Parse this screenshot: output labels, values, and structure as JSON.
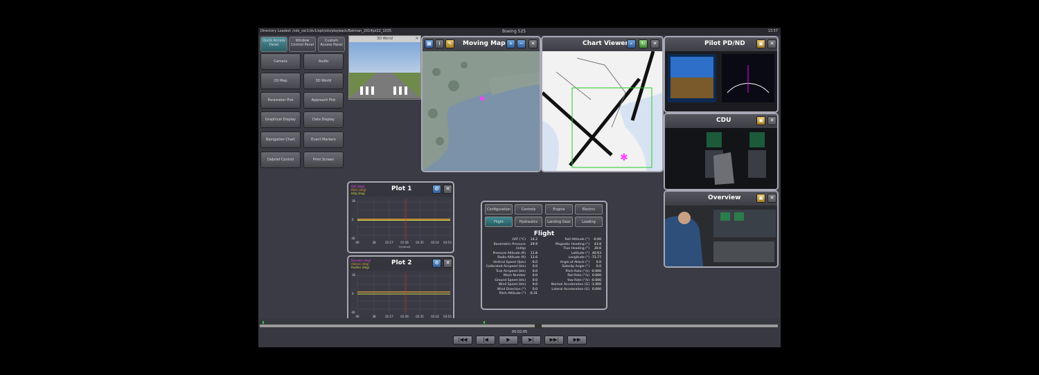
{
  "top_bar": {
    "directory": "Directory Loaded:  /sds_var1/dv1/opt/sds/playback/Batman_2014jul22_1035",
    "aircraft": "Boeing 525",
    "clock": "13:57"
  },
  "left_tabs": [
    {
      "label": "Quick Access Panel",
      "active": true
    },
    {
      "label": "Window Control Panel",
      "active": false
    },
    {
      "label": "Custom Access Panel",
      "active": false
    }
  ],
  "left_buttons": [
    "Camera",
    "Audio",
    "2D Map",
    "3D World",
    "Parameter Plot",
    "Approach Plot",
    "Graphical Display",
    "Data Display",
    "Navigation Chart",
    "Event Markers",
    "Debrief Control",
    "Print Screen"
  ],
  "window_3d": {
    "title": "3D World"
  },
  "moving_map": {
    "title": "Moving Map"
  },
  "chart_viewer": {
    "title": "Chart Viewer"
  },
  "pilot_pfd": {
    "title": "Pilot PD/ND"
  },
  "cdu": {
    "title": "CDU"
  },
  "overview": {
    "title": "Overview"
  },
  "plot1": {
    "title": "Plot 1",
    "legend": [
      "Roll (deg)",
      "Pitch (deg)",
      "Hdg (deg)"
    ],
    "y_ticks": [
      "30",
      "0",
      "-30"
    ],
    "x_ticks": [
      "00",
      "38",
      "01:17",
      "01:56",
      "02:35",
      "03:14",
      "03:53"
    ],
    "x_label": "t (mm:ss)"
  },
  "plot2": {
    "title": "Plot 2",
    "legend": [
      "Elevator (deg)",
      "Aileron (deg)",
      "Rudder (deg)"
    ],
    "y_ticks": [
      "30",
      "0",
      "-30"
    ],
    "x_ticks": [
      "00",
      "38",
      "01:17",
      "01:56",
      "02:35",
      "03:14",
      "03:53"
    ],
    "x_label": "t (mm:ss)"
  },
  "data_display": {
    "tabs": [
      "Configuration",
      "Controls",
      "Engine",
      "Electric",
      "Flight",
      "Hydraulics",
      "Landing Gear",
      "Loading"
    ],
    "active_tab": "Flight",
    "title": "Flight",
    "left_params": [
      {
        "label": "OAT (°C)",
        "value": "14.2"
      },
      {
        "label": "Barometric Pressure (inHg)",
        "value": "29.9"
      },
      {
        "label": "Pressure Altitude (ft)",
        "value": "11.8"
      },
      {
        "label": "Radio Altitude (ft)",
        "value": "11.6"
      },
      {
        "label": "Vertical Speed (fpm)",
        "value": "-0.0"
      },
      {
        "label": "Calibrated Airspeed (kts)",
        "value": "0.0"
      },
      {
        "label": "True Airspeed (kts)",
        "value": "0.0"
      },
      {
        "label": "Mach Number",
        "value": "0.0"
      },
      {
        "label": "Ground Speed (kts)",
        "value": "0.0"
      },
      {
        "label": "Wind Speed (kts)",
        "value": "0.0"
      },
      {
        "label": "Wind Direction (°)",
        "value": "0.0"
      },
      {
        "label": "Pitch Attitude (°)",
        "value": "-0.31"
      }
    ],
    "right_params": [
      {
        "label": "Roll Attitude (°)",
        "value": "-0.00"
      },
      {
        "label": "Magnetic Heading (°)",
        "value": "43.8"
      },
      {
        "label": "True Heading (°)",
        "value": "30.6"
      },
      {
        "label": "Latitude (°)",
        "value": "40.63"
      },
      {
        "label": "Longitude (°)",
        "value": "-73.77"
      },
      {
        "label": "Angle of Attack (°)",
        "value": "0.0"
      },
      {
        "label": "Sideslip Angle (°)",
        "value": "0.0"
      },
      {
        "label": "Pitch Rate (°/s)",
        "value": "-0.000"
      },
      {
        "label": "Roll Rate (°/s)",
        "value": "0.000"
      },
      {
        "label": "Yaw Rate (°/s)",
        "value": "-0.000"
      },
      {
        "label": "Normal Acceleration (G)",
        "value": "-1.000"
      },
      {
        "label": "Lateral Acceleration (G)",
        "value": "0.000"
      }
    ]
  },
  "timeline": {
    "current_time": "00:02:05",
    "controls": [
      "|◀◀",
      "|◀",
      "▶",
      "▶|",
      "▶▶|",
      "▶▶"
    ]
  }
}
